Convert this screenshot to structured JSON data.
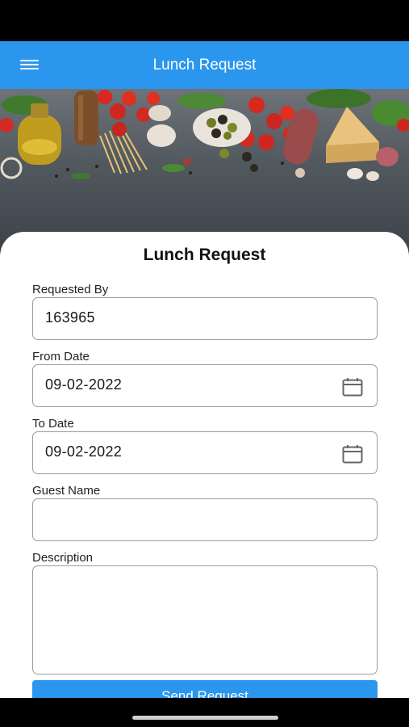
{
  "app_bar": {
    "title": "Lunch Request",
    "menu_icon": "hamburger-menu-icon"
  },
  "form": {
    "title": "Lunch Request",
    "requested_by": {
      "label": "Requested By",
      "value": "163965"
    },
    "from_date": {
      "label": "From Date",
      "value": "09-02-2022",
      "icon": "calendar-icon"
    },
    "to_date": {
      "label": "To Date",
      "value": "09-02-2022",
      "icon": "calendar-icon"
    },
    "guest_name": {
      "label": "Guest Name",
      "value": ""
    },
    "description": {
      "label": "Description",
      "value": ""
    },
    "submit_label": "Send Request"
  },
  "colors": {
    "primary": "#2b96ee",
    "field_border": "#9a9a9a",
    "background": "#ffffff"
  }
}
